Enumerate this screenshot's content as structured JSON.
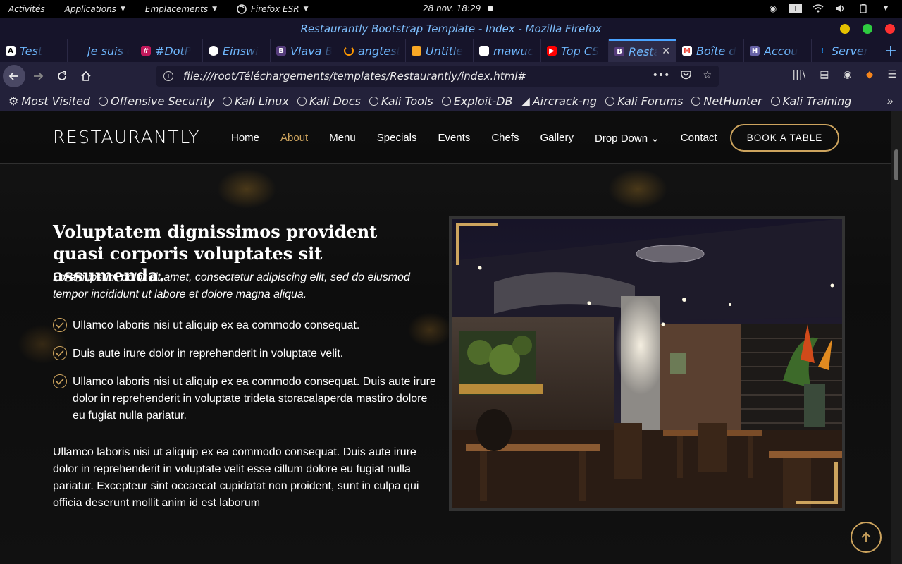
{
  "os_bar": {
    "activities": "Activités",
    "applications": "Applications",
    "places": "Emplacements",
    "firefox_app": "Firefox ESR",
    "clock": "28 nov.  18:29"
  },
  "window": {
    "title": "Restaurantly Bootstrap Template - Index - Mozilla Firefox"
  },
  "tabs": [
    {
      "label": "Test",
      "icon": "a-icon",
      "color": "#ffffff"
    },
    {
      "label": "Je suis ca",
      "icon": "none",
      "color": "#16142a"
    },
    {
      "label": "#DotP",
      "icon": "dotp-icon",
      "color": "#c2185b"
    },
    {
      "label": "Einswi",
      "icon": "github-icon",
      "color": "#ffffff"
    },
    {
      "label": "Vlava B",
      "icon": "bootstrap-icon",
      "color": "#563d7c"
    },
    {
      "label": "angtest",
      "icon": "spinner-icon",
      "color": "#ff9800"
    },
    {
      "label": "Untitle",
      "icon": "book-icon",
      "color": "#f9a825"
    },
    {
      "label": "mawuc",
      "icon": "leaf-icon",
      "color": "#ffffff"
    },
    {
      "label": "Top CS",
      "icon": "youtube-icon",
      "color": "#ff0000"
    },
    {
      "label": "Resta",
      "icon": "bootstrap-icon",
      "color": "#563d7c",
      "active": true
    },
    {
      "label": "Boîte d",
      "icon": "gmail-icon",
      "color": "#ea4335"
    },
    {
      "label": "Accou",
      "icon": "heroku-icon",
      "color": "#6762a6"
    },
    {
      "label": "Server",
      "icon": "warning-icon",
      "color": "#1e88e5"
    }
  ],
  "urlbar": {
    "url": "file:///root/Téléchargements/templates/Restaurantly/index.html#"
  },
  "bookmarks": [
    "Most Visited",
    "Offensive Security",
    "Kali Linux",
    "Kali Docs",
    "Kali Tools",
    "Exploit-DB",
    "Aircrack-ng",
    "Kali Forums",
    "NetHunter",
    "Kali Training"
  ],
  "site": {
    "logo": "RESTAURANTLY",
    "nav": [
      {
        "label": "Home"
      },
      {
        "label": "About",
        "active": true
      },
      {
        "label": "Menu"
      },
      {
        "label": "Specials"
      },
      {
        "label": "Events"
      },
      {
        "label": "Chefs"
      },
      {
        "label": "Gallery"
      },
      {
        "label": "Drop Down"
      },
      {
        "label": "Contact"
      }
    ],
    "cta": "BOOK A TABLE",
    "accent": "#cda45e"
  },
  "about": {
    "title": "Voluptatem dignissimos provident quasi corporis voluptates sit assumenda.",
    "lead": "Lorem ipsum dolor sit amet, consectetur adipiscing elit, sed do eiusmod tempor incididunt ut labore et dolore magna aliqua.",
    "checks": [
      "Ullamco laboris nisi ut aliquip ex ea commodo consequat.",
      "Duis aute irure dolor in reprehenderit in voluptate velit.",
      "Ullamco laboris nisi ut aliquip ex ea commodo consequat. Duis aute irure dolor in reprehenderit in voluptate trideta storacalaperda mastiro dolore eu fugiat nulla pariatur."
    ],
    "paragraph": "Ullamco laboris nisi ut aliquip ex ea commodo consequat. Duis aute irure dolor in reprehenderit in voluptate velit esse cillum dolore eu fugiat nulla pariatur. Excepteur sint occaecat cupidatat non proident, sunt in culpa qui officia deserunt mollit anim id est laborum"
  }
}
